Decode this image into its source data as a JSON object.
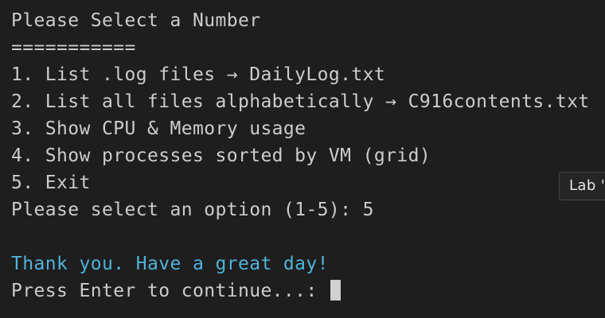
{
  "terminal": {
    "lines": [
      {
        "text": "Please Select a Number",
        "style": "normal"
      },
      {
        "text": "===========",
        "style": "normal"
      },
      {
        "text": "1. List .log files → DailyLog.txt",
        "style": "normal"
      },
      {
        "text": "2. List all files alphabetically → C916contents.txt",
        "style": "normal"
      },
      {
        "text": "3. Show CPU & Memory usage",
        "style": "normal"
      },
      {
        "text": "4. Show processes sorted by VM (grid)",
        "style": "normal"
      },
      {
        "text": "5. Exit",
        "style": "normal"
      },
      {
        "text": "Please select an option (1-5): 5",
        "style": "normal"
      },
      {
        "text": "",
        "style": "normal"
      },
      {
        "text": "Thank you. Have a great day!",
        "style": "blue"
      },
      {
        "text": "Press Enter to continue...: ",
        "style": "normal"
      }
    ]
  },
  "tooltip": {
    "label": "Lab '"
  },
  "colors": {
    "background": "#1e1e1e",
    "text": "#cccccc",
    "accent_blue": "#4fb3d9",
    "cursor": "#d0d0d0"
  }
}
